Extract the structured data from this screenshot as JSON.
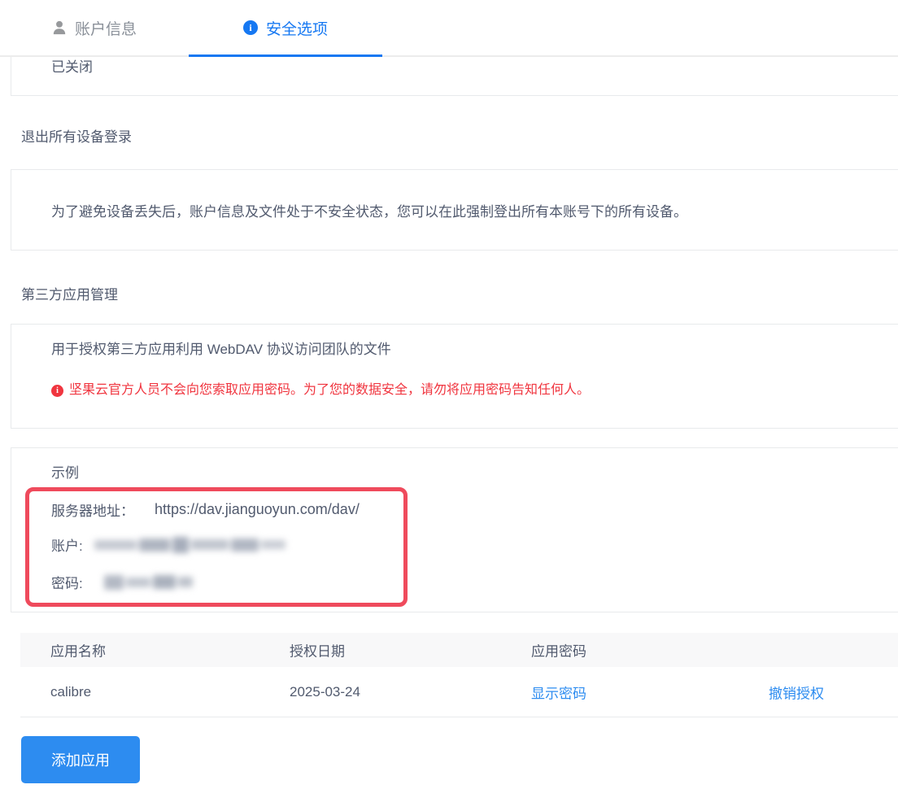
{
  "tabs": {
    "account": {
      "label": "账户信息",
      "icon": "person-icon"
    },
    "security": {
      "label": "安全选项",
      "icon": "info-icon",
      "active": true
    }
  },
  "two_step_status": "已关闭",
  "logout_section": {
    "title": "退出所有设备登录",
    "description": "为了避免设备丢失后，账户信息及文件处于不安全状态，您可以在此强制登出所有本账号下的所有设备。"
  },
  "third_party_section": {
    "title": "第三方应用管理",
    "description": "用于授权第三方应用利用 WebDAV 协议访问团队的文件",
    "warning": "坚果云官方人员不会向您索取应用密码。为了您的数据安全，请勿将应用密码告知任何人。"
  },
  "example": {
    "title": "示例",
    "server_label": "服务器地址：",
    "server_value": "https://dav.jianguoyun.com/dav/",
    "account_label": "账户:",
    "account_value_redacted": true,
    "password_label": "密码:",
    "password_value_redacted": true
  },
  "apps_table": {
    "headers": [
      "应用名称",
      "授权日期",
      "应用密码"
    ],
    "rows": [
      {
        "name": "calibre",
        "date": "2025-03-24",
        "password_action": "显示密码",
        "revoke_action": "撤销授权"
      }
    ]
  },
  "add_app_button": "添加应用",
  "icon_glyphs": {
    "info": "i",
    "warning": "i"
  },
  "colors": {
    "tab_active_blue": "#1678f2",
    "link_blue": "#2d8cf0",
    "warning_red": "#f0353f",
    "annotation_rect_red": "#ef4a5c",
    "text_main": "#515a6e",
    "tab_inactive_gray": "#8a9099",
    "border_gray": "#e8eaec",
    "table_header_bg": "#f8f8f9"
  }
}
